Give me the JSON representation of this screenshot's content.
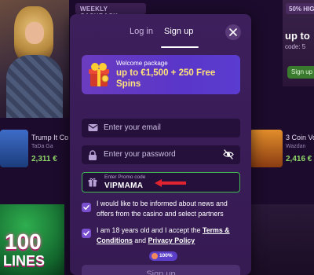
{
  "background": {
    "promo_tag_left": "WEEKLY CASHBACK",
    "promo_tag_right": "50% HIG",
    "right_banner_title": "up to",
    "right_banner_code": "code: 5",
    "right_banner_button": "Sign up",
    "game_left": {
      "title": "Trump It Co",
      "provider": "TaDa Ga",
      "amount": "2,311 €"
    },
    "game_right": {
      "title": "3 Coin Vo",
      "provider": "Wazdan",
      "amount": "2,416 €"
    },
    "game_banner_line1": "100",
    "game_banner_line2": "LINES"
  },
  "modal": {
    "tabs": {
      "login": "Log in",
      "signup": "Sign up"
    },
    "active_tab": "signup",
    "welcome": {
      "small": "Welcome package",
      "big": "up to €1,500 + 250 Free Spins"
    },
    "email_placeholder": "Enter your email",
    "password_placeholder": "Enter your password",
    "promo": {
      "label": "Enter Promo code",
      "value": "VIPMAMA"
    },
    "consent_news": "I would like to be informed about news and offers from the casino and select partners",
    "consent_age": {
      "pre": "I am 18 years old and I accept the ",
      "terms": "Terms & Conditions",
      "mid": " and ",
      "privacy": "Privacy Policy"
    },
    "progress": "100%",
    "submit": "Sign up"
  },
  "colors": {
    "accent": "#7a4fd0",
    "promo_border": "#3fb950",
    "welcome_highlight": "#ffe27a",
    "arrow": "#e0232e"
  }
}
